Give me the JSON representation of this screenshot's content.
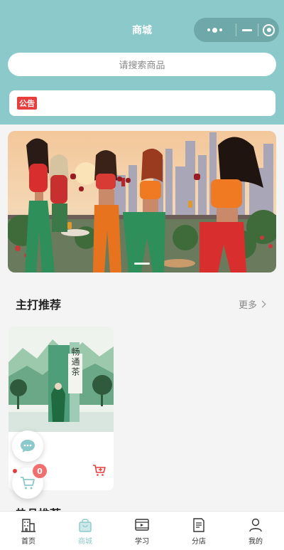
{
  "header": {
    "title": "商城"
  },
  "search": {
    "placeholder": "请搜索商品"
  },
  "notice": {
    "tag": "公告"
  },
  "section": {
    "title": "主打推荐",
    "more_label": "更多"
  },
  "product": {
    "name": "畅通茶"
  },
  "peek_section_title": "热品推荐",
  "cart": {
    "badge_count": "0"
  },
  "tabs": [
    {
      "label": "首页",
      "icon": "building-icon"
    },
    {
      "label": "商城",
      "icon": "shopping-bag-icon",
      "active": true
    },
    {
      "label": "学习",
      "icon": "video-player-icon"
    },
    {
      "label": "分店",
      "icon": "document-icon"
    },
    {
      "label": "我的",
      "icon": "user-icon"
    }
  ],
  "colors": {
    "accent": "#8cc9cb",
    "danger": "#e83e3e",
    "badge": "#f07070"
  }
}
